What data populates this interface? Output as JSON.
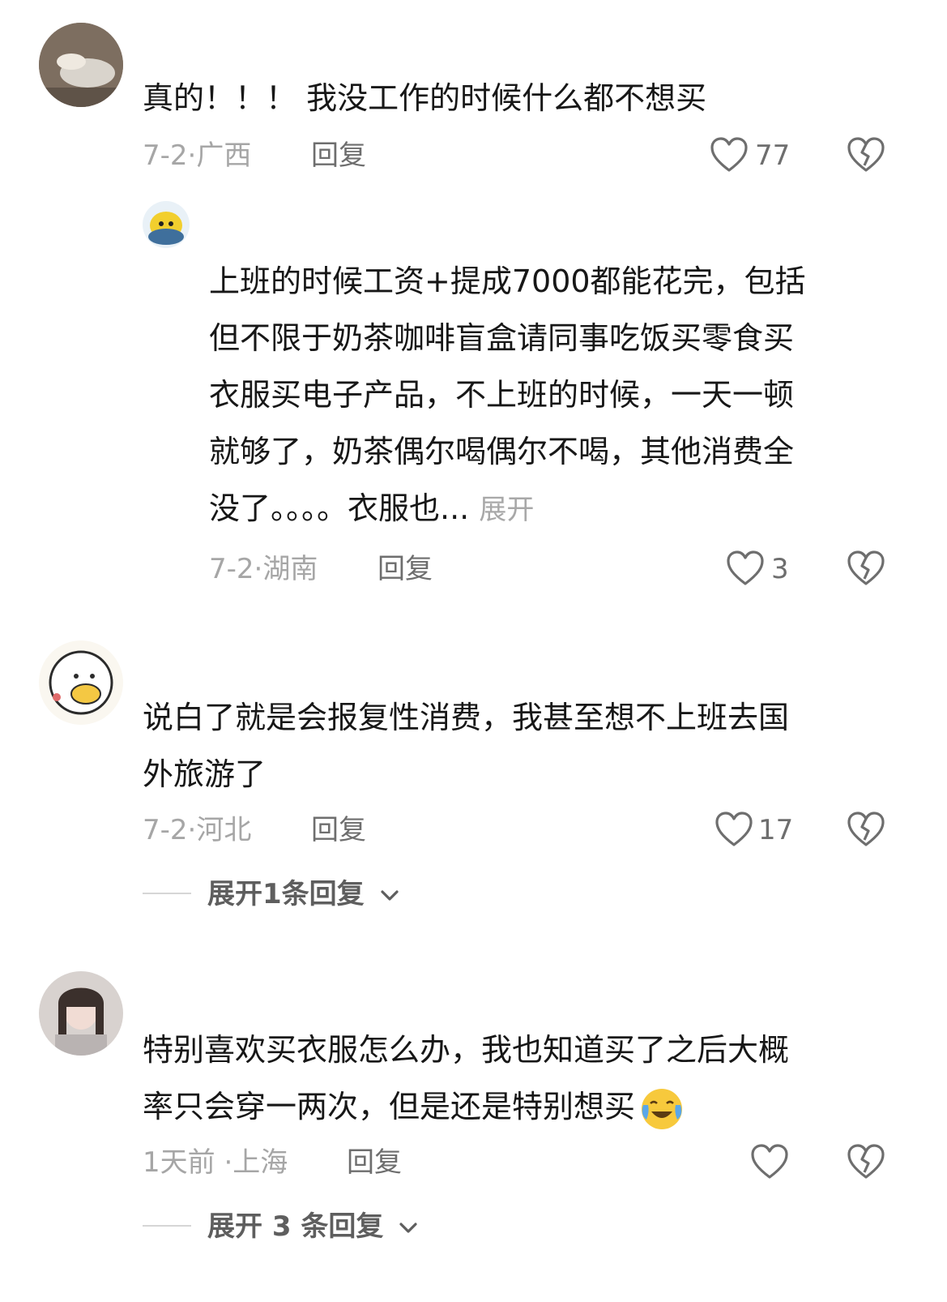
{
  "comments": [
    {
      "text_lines": [
        "真的！！！ 我没工作的时候什么都不想买"
      ],
      "date": "7-2·",
      "location": "广西",
      "reply_label": "回复",
      "likes": "77"
    },
    {
      "text_lines": [
        "上班的时候工资+提成7000都能花完，包括",
        "但不限于奶茶咖啡盲盒请同事吃饭买零食买",
        "衣服买电子产品，不上班的时候，一天一顿",
        "就够了，奶茶偶尔喝偶尔不喝，其他消费全",
        "没了。。。。衣服也..."
      ],
      "expand_inline": "展开",
      "date": "7-2·",
      "location": "湖南",
      "reply_label": "回复",
      "likes": "3"
    },
    {
      "text_lines": [
        "说白了就是会报复性消费，我甚至想不上班去国",
        "外旅游了"
      ],
      "date": "7-2·",
      "location": "河北",
      "reply_label": "回复",
      "likes": "17",
      "expand_replies": "展开1条回复"
    },
    {
      "text_lines": [
        "特别喜欢买衣服怎么办，我也知道买了之后大概",
        "率只会穿一两次，但是还是特别想买"
      ],
      "emoji": "crying-laughing-emoji",
      "date": "1天前 ·",
      "location": "上海",
      "reply_label": "回复",
      "likes": "",
      "expand_replies": "展开 3 条回复"
    }
  ],
  "icons": {
    "like": "heart-outline-icon",
    "dislike": "broken-heart-icon",
    "chevron": "chevron-down-icon"
  },
  "colors": {
    "text": "#171717",
    "meta": "#a6a6a6",
    "reply": "#6e6e6e"
  }
}
